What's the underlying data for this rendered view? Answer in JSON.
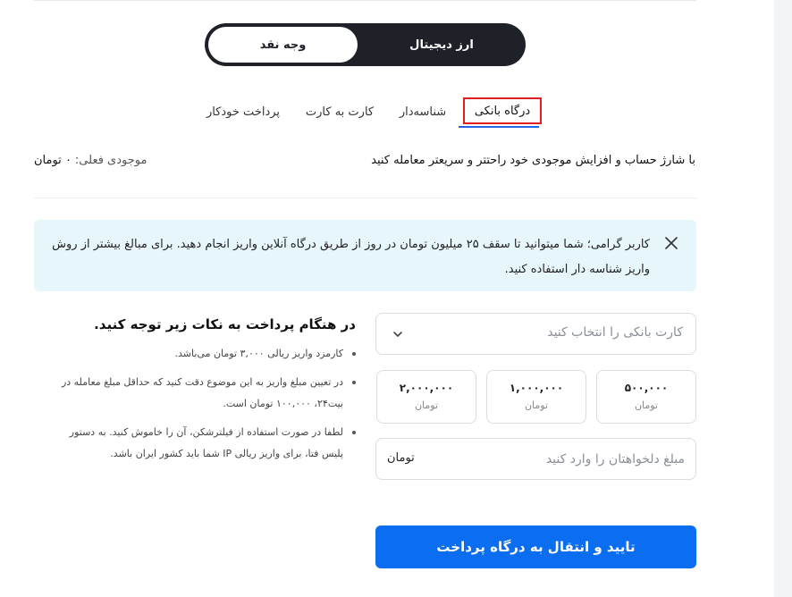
{
  "currency_toggle": {
    "cash_label": "وجه نقد",
    "crypto_label": "ارز دیجیتال",
    "selected": "cash"
  },
  "tabs": [
    {
      "label": "پرداخت خودکار"
    },
    {
      "label": "کارت به کارت"
    },
    {
      "label": "شناسه‌دار"
    },
    {
      "label": "درگاه بانکی",
      "active": true
    }
  ],
  "intro": {
    "text": "با شارژ حساب و افزایش موجودی خود راحتتر و سریعتر معامله کنید",
    "balance_label": "موجودی فعلی:",
    "balance_value": "۰ تومان"
  },
  "notice": {
    "message": "کاربر گرامی؛ شما میتوانید تا سقف ۲۵ میلیون تومان در روز از طریق درگاه آنلاین واریز انجام دهید. برای مبالغ بیشتر از روش واریز شناسه دار استفاده کنید.",
    "close_icon": "close-icon"
  },
  "tips": {
    "title": "در هنگام پرداخت به نکات زیر توجه کنید.",
    "items": [
      "کارمزد واریز ریالی ۳,۰۰۰ تومان می‌باشد.",
      "در تعیین مبلغ واریز به این موضوع دقت کنید که حداقل مبلغ معامله در بیت۲۴، ۱۰۰,۰۰۰ تومان است.",
      "لطفا در صورت استفاده از فیلترشکن، آن را خاموش کنید. به دستور پلیس فتا، برای واریز ریالی IP شما باید کشور ایران باشد."
    ]
  },
  "form": {
    "card_select_placeholder": "کارت بانکی را انتخاب کنید",
    "presets": [
      {
        "amount": "۵۰۰,۰۰۰",
        "unit": "تومان"
      },
      {
        "amount": "۱,۰۰۰,۰۰۰",
        "unit": "تومان"
      },
      {
        "amount": "۲,۰۰۰,۰۰۰",
        "unit": "تومان"
      }
    ],
    "amount_placeholder": "مبلغ دلخواهتان را وارد کنید",
    "amount_unit": "تومان",
    "submit_label": "تایید و انتقال به درگاه پرداخت"
  },
  "colors": {
    "accent": "#0b6ef0",
    "toggle_bg": "#1f2128",
    "notice_bg": "#e6f6fb",
    "highlight": "#e02020"
  }
}
